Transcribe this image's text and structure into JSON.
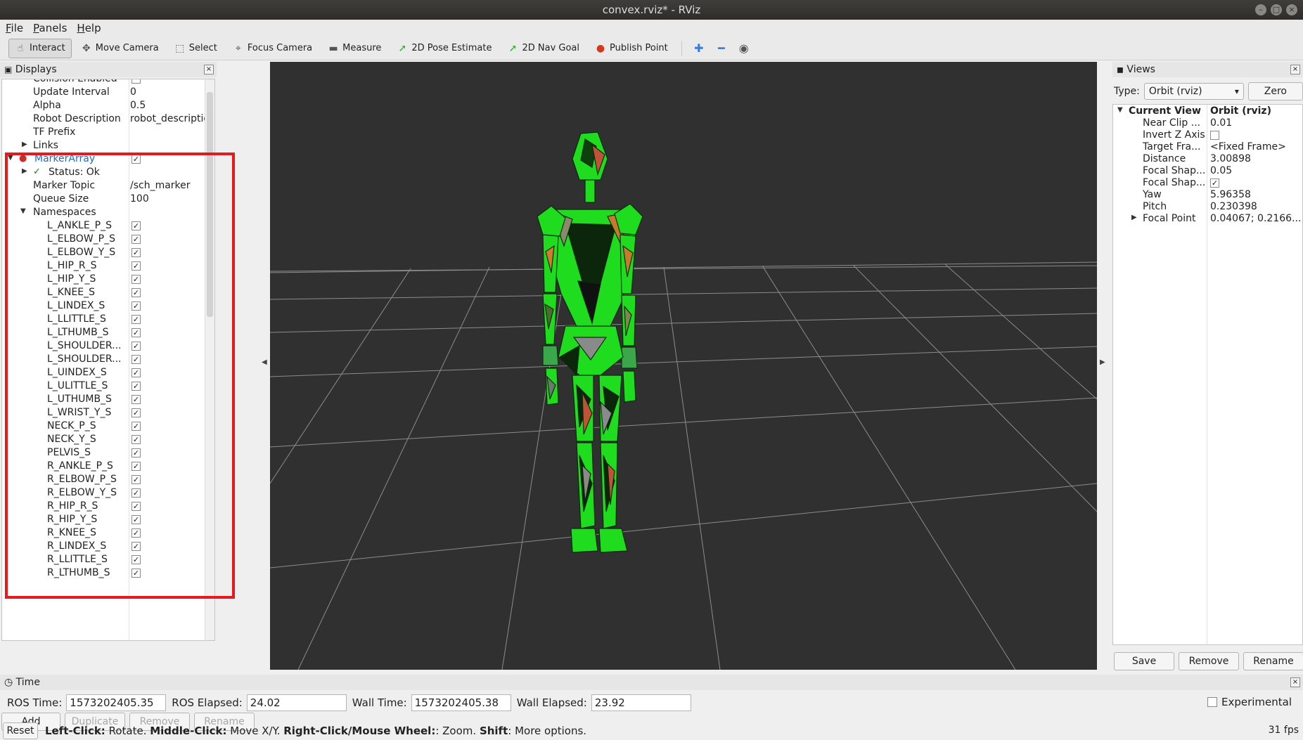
{
  "window": {
    "title": "convex.rviz* - RViz"
  },
  "menu": [
    "File",
    "Panels",
    "Help"
  ],
  "toolbar": {
    "tools": [
      {
        "label": "Interact",
        "icon": "hand-icon"
      },
      {
        "label": "Move Camera",
        "icon": "move-camera-icon"
      },
      {
        "label": "Select",
        "icon": "select-box-icon"
      },
      {
        "label": "Focus Camera",
        "icon": "focus-icon"
      },
      {
        "label": "Measure",
        "icon": "ruler-icon"
      },
      {
        "label": "2D Pose Estimate",
        "icon": "green-arrow-icon"
      },
      {
        "label": "2D Nav Goal",
        "icon": "green-arrow-icon"
      },
      {
        "label": "Publish Point",
        "icon": "map-pin-icon"
      }
    ]
  },
  "displays": {
    "title": "Displays",
    "rows_top": [
      {
        "key": "Collision Enabled",
        "value": "",
        "checkbox": "unchecked"
      },
      {
        "key": "Update Interval",
        "value": "0"
      },
      {
        "key": "Alpha",
        "value": "0.5"
      },
      {
        "key": "Robot Description",
        "value": "robot_description"
      },
      {
        "key": "TF Prefix",
        "value": ""
      },
      {
        "key": "Links",
        "value": ""
      }
    ],
    "marker_array": {
      "label": "MarkerArray",
      "status": "Status: Ok",
      "marker_topic_key": "Marker Topic",
      "marker_topic": "/sch_marker",
      "queue_size_key": "Queue Size",
      "queue_size": "100",
      "namespaces_key": "Namespaces",
      "namespaces": [
        "L_ANKLE_P_S",
        "L_ELBOW_P_S",
        "L_ELBOW_Y_S",
        "L_HIP_R_S",
        "L_HIP_Y_S",
        "L_KNEE_S",
        "L_LINDEX_S",
        "L_LLITTLE_S",
        "L_LTHUMB_S",
        "L_SHOULDER...",
        "L_SHOULDER...",
        "L_UINDEX_S",
        "L_ULITTLE_S",
        "L_UTHUMB_S",
        "L_WRIST_Y_S",
        "NECK_P_S",
        "NECK_Y_S",
        "PELVIS_S",
        "R_ANKLE_P_S",
        "R_ELBOW_P_S",
        "R_ELBOW_Y_S",
        "R_HIP_R_S",
        "R_HIP_Y_S",
        "R_KNEE_S",
        "R_LINDEX_S",
        "R_LLITTLE_S",
        "R_LTHUMB_S"
      ]
    },
    "buttons": [
      "Add",
      "Duplicate",
      "Remove",
      "Rename"
    ]
  },
  "views": {
    "title": "Views",
    "type_label": "Type:",
    "type_value": "Orbit (rviz)",
    "zero_label": "Zero",
    "current_view": {
      "key": "Current View",
      "value": "Orbit (rviz)"
    },
    "props": [
      {
        "key": "Near Clip ...",
        "value": "0.01"
      },
      {
        "key": "Invert Z Axis",
        "value": "",
        "checkbox": "unchecked"
      },
      {
        "key": "Target Fra...",
        "value": "<Fixed Frame>"
      },
      {
        "key": "Distance",
        "value": "3.00898"
      },
      {
        "key": "Focal Shap...",
        "value": "0.05"
      },
      {
        "key": "Focal Shap...",
        "value": "",
        "checkbox": "checked"
      },
      {
        "key": "Yaw",
        "value": "5.96358"
      },
      {
        "key": "Pitch",
        "value": "0.230398"
      },
      {
        "key": "Focal Point",
        "value": "0.04067; 0.2166..."
      }
    ],
    "buttons": [
      "Save",
      "Remove",
      "Rename"
    ]
  },
  "time": {
    "title": "Time",
    "ros_time_label": "ROS Time:",
    "ros_time": "1573202405.35",
    "ros_elapsed_label": "ROS Elapsed:",
    "ros_elapsed": "24.02",
    "wall_time_label": "Wall Time:",
    "wall_time": "1573202405.38",
    "wall_elapsed_label": "Wall Elapsed:",
    "wall_elapsed": "23.92",
    "experimental_label": "Experimental"
  },
  "status": {
    "reset_label": "Reset",
    "hint_parts": [
      {
        "bold": "Left-Click:",
        "text": " Rotate. "
      },
      {
        "bold": "Middle-Click:",
        "text": " Move X/Y. "
      },
      {
        "bold": "Right-Click/Mouse Wheel:",
        "text": ": Zoom. "
      },
      {
        "bold": "Shift",
        "text": ": More options."
      }
    ],
    "fps": "31 fps"
  },
  "colors": {
    "highlight": "#e8191d",
    "viewport_bg": "#303030",
    "grid": "#8c8c8c",
    "robot_green": "#1fdc1f"
  }
}
